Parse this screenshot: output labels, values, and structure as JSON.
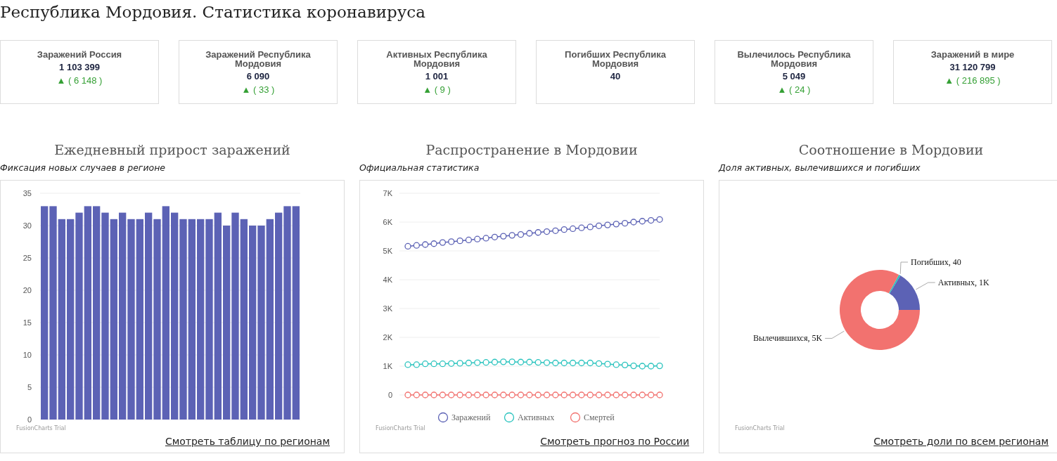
{
  "page_title": "Республика Мордовия. Статистика коронавируса",
  "cards": [
    {
      "label": "Заражений Россия",
      "value": "1 103 399",
      "delta": "▲ ( 6 148 )"
    },
    {
      "label": "Заражений Республика Мордовия",
      "value": "6 090",
      "delta": "▲ ( 33 )"
    },
    {
      "label": "Активных Республика Мордовия",
      "value": "1 001",
      "delta": "▲ ( 9 )"
    },
    {
      "label": "Погибших Республика Мордовия",
      "value": "40"
    },
    {
      "label": "Вылечилось Республика Мордовия",
      "value": "5 049",
      "delta": "▲ ( 24 )"
    },
    {
      "label": "Заражений в мире",
      "value": "31 120 799",
      "delta": "▲ ( 216 895 )"
    }
  ],
  "panels": [
    {
      "title": "Ежедневный прирост заражений",
      "subtitle": "Фиксация новых случаев в регионе",
      "credit": "FusionCharts Trial",
      "link": "Смотреть таблицу по регионам",
      "chart_data": {
        "type": "bar",
        "ylim": [
          0,
          35
        ],
        "yticks": [
          0,
          5,
          10,
          15,
          20,
          25,
          30,
          35
        ],
        "grid": true,
        "color": "#5c62b5",
        "values": [
          33,
          33,
          31,
          31,
          32,
          33,
          33,
          32,
          31,
          32,
          31,
          31,
          32,
          31,
          33,
          32,
          31,
          31,
          31,
          31,
          32,
          30,
          32,
          31,
          30,
          30,
          31,
          32,
          33,
          33
        ]
      }
    },
    {
      "title": "Распространение в Мордовии",
      "subtitle": "Официальная статистика",
      "credit": "FusionCharts Trial",
      "link": "Смотреть прогноз по России",
      "chart_data": {
        "type": "line",
        "ylim": [
          0,
          7000
        ],
        "yticks": [
          {
            "value": 0,
            "label": "0"
          },
          {
            "value": 1000,
            "label": "1K"
          },
          {
            "value": 2000,
            "label": "2K"
          },
          {
            "value": 3000,
            "label": "3K"
          },
          {
            "value": 4000,
            "label": "4K"
          },
          {
            "value": 5000,
            "label": "5K"
          },
          {
            "value": 6000,
            "label": "6K"
          },
          {
            "value": 7000,
            "label": "7K"
          }
        ],
        "grid": true,
        "legend": true,
        "series": [
          {
            "name": "Заражений",
            "color": "#5c62b5",
            "marker": "circle",
            "values": [
              5160,
              5190,
              5220,
              5250,
              5290,
              5320,
              5350,
              5380,
              5410,
              5440,
              5480,
              5510,
              5540,
              5570,
              5610,
              5640,
              5670,
              5700,
              5740,
              5770,
              5800,
              5830,
              5870,
              5900,
              5930,
              5960,
              6000,
              6030,
              6060,
              6090
            ]
          },
          {
            "name": "Активных",
            "color": "#29c3be",
            "marker": "circle",
            "values": [
              1050,
              1050,
              1080,
              1080,
              1080,
              1090,
              1100,
              1110,
              1120,
              1130,
              1140,
              1150,
              1150,
              1140,
              1140,
              1130,
              1120,
              1110,
              1110,
              1110,
              1110,
              1110,
              1090,
              1070,
              1050,
              1040,
              1010,
              1000,
              1000,
              1010
            ]
          },
          {
            "name": "Смертей",
            "color": "#f2726f",
            "marker": "circle",
            "values": [
              0,
              0,
              0,
              0,
              0,
              0,
              0,
              0,
              0,
              0,
              0,
              0,
              0,
              0,
              0,
              0,
              0,
              0,
              0,
              0,
              0,
              0,
              0,
              0,
              0,
              0,
              0,
              0,
              0,
              0
            ]
          }
        ]
      }
    },
    {
      "title": "Соотношение в Мордовии",
      "subtitle": "Доля активных, вылечившихся и погибших",
      "credit": "FusionCharts Trial",
      "link": "Смотреть доли по всем регионам",
      "chart_data": {
        "type": "donut",
        "categories": [
          "Активных, 1K",
          "Погибших, 40",
          "Вылечившихся, 5K"
        ],
        "values": [
          16.4,
          0.7,
          82.9
        ],
        "colors": [
          "#5c62b5",
          "#29c3be",
          "#f2726f"
        ]
      }
    }
  ]
}
